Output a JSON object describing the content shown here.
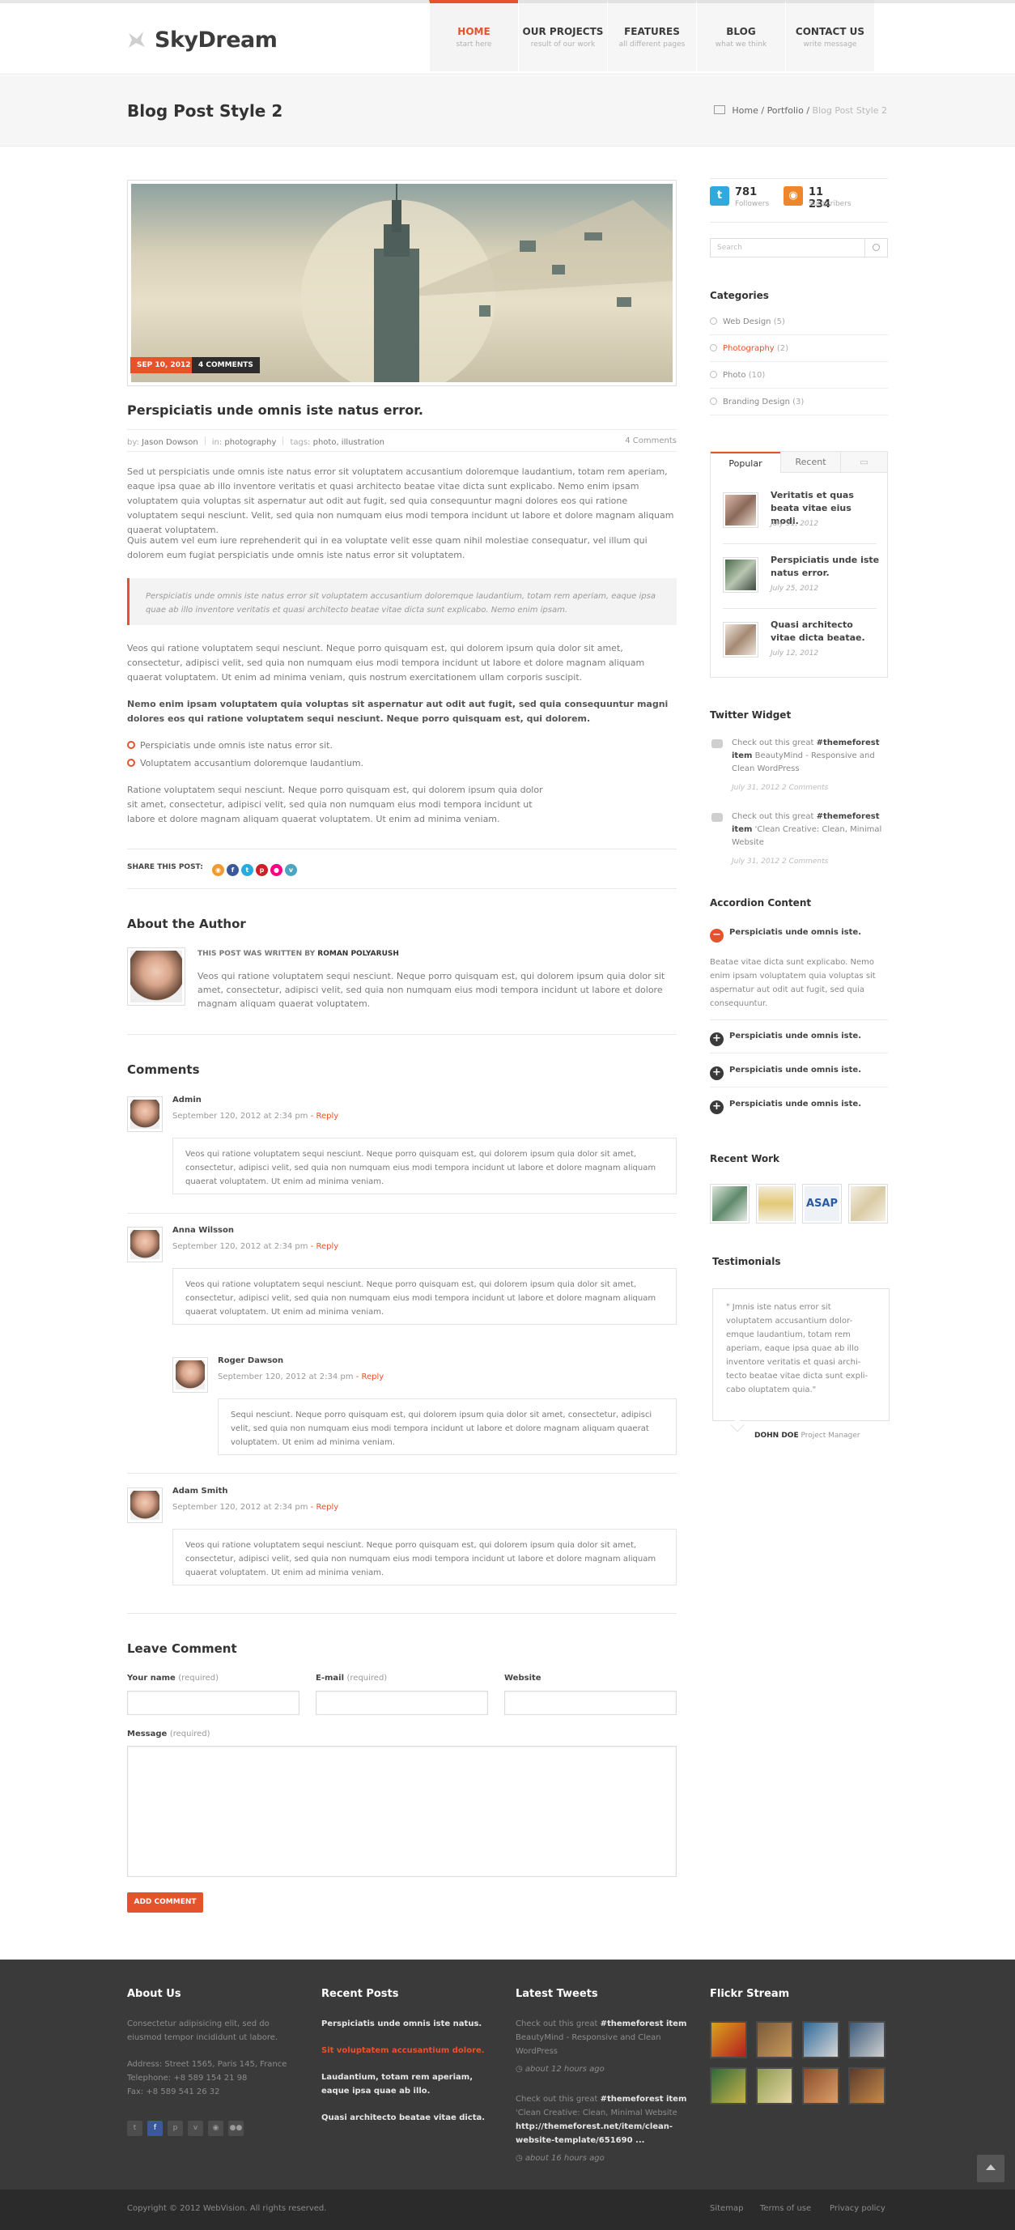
{
  "brand": {
    "name": "SkyDream"
  },
  "nav": [
    {
      "title": "HOME",
      "sub": "start here"
    },
    {
      "title": "OUR PROJECTS",
      "sub": "result of our work"
    },
    {
      "title": "FEATURES",
      "sub": "all different pages"
    },
    {
      "title": "BLOG",
      "sub": "what we think"
    },
    {
      "title": "CONTACT US",
      "sub": "write message"
    }
  ],
  "page": {
    "title": "Blog Post Style 2"
  },
  "breadcrumb": {
    "home": "Home",
    "sep": "/",
    "mid": "Portfolio",
    "current": "Blog Post Style 2"
  },
  "post": {
    "date_badge": "SEP 10, 2012",
    "comments_badge": "4 COMMENTS",
    "title": "Perspiciatis unde omnis iste natus error.",
    "meta": {
      "by_label": "by:",
      "author": "Jason Dowson",
      "in_label": "in:",
      "category": "photography",
      "tags_label": "tags:",
      "tags": "photo, illustration",
      "comments": "4 Comments"
    },
    "p1": "Sed ut perspiciatis unde omnis iste natus error sit voluptatem accusantium doloremque laudantium, totam rem aperiam, eaque ipsa quae ab illo inventore veritatis et quasi architecto beatae vitae dicta sunt explicabo. Nemo enim ipsam voluptatem quia voluptas sit aspernatur aut odit aut fugit, sed quia consequuntur magni dolores eos qui ratione voluptatem sequi nesciunt. Velit, sed quia non numquam eius modi tempora incidunt ut labore et dolore magnam aliquam quaerat voluptatem.",
    "p2": "Quis autem vel eum iure reprehenderit qui in ea voluptate velit esse quam nihil molestiae consequatur, vel illum qui dolorem eum fugiat perspiciatis unde omnis iste natus error sit voluptatem.",
    "quote": "Perspiciatis unde omnis iste natus error sit voluptatem accusantium doloremque laudantium, totam rem aperiam, eaque ipsa quae ab illo inventore veritatis et quasi architecto beatae vitae dicta sunt explicabo. Nemo enim ipsam.",
    "p3": "Veos qui ratione voluptatem sequi nesciunt. Neque porro quisquam est, qui dolorem ipsum quia dolor sit amet, consectetur, adipisci velit, sed quia non numquam eius modi tempora incidunt ut labore et dolore magnam aliquam quaerat voluptatem. Ut enim ad minima veniam, quis nostrum exercitationem ullam corporis suscipit.",
    "p4": "Nemo enim ipsam voluptatem quia voluptas sit aspernatur aut odit aut fugit, sed quia consequuntur magni dolores eos qui ratione voluptatem sequi nesciunt. Neque porro quisquam est, qui dolorem.",
    "list": [
      "Perspiciatis unde omnis iste natus error sit.",
      "Voluptatem accusantium doloremque laudantium."
    ],
    "p5": "Ratione voluptatem sequi nesciunt. Neque porro quisquam est, qui dolorem ipsum quia dolor sit amet, consectetur, adipisci velit, sed quia non numquam eius modi tempora incidunt ut labore et dolore magnam aliquam quaerat voluptatem. Ut enim ad minima veniam.",
    "share_label": "SHARE THIS POST:"
  },
  "author": {
    "heading": "About the Author",
    "by_label": "THIS POST WAS WRITTEN BY",
    "name": "ROMAN POLYARUSH",
    "bio": "Veos qui ratione voluptatem sequi nesciunt. Neque porro quisquam est, qui dolorem ipsum quia dolor sit amet, consectetur, adipisci velit, sed quia non numquam eius modi tempora incidunt ut labore et dolore magnam aliquam quaerat voluptatem."
  },
  "comments": {
    "heading": "Comments",
    "reply": "- Reply",
    "items": [
      {
        "name": "Admin",
        "date": "September 120, 2012 at 2:34 pm",
        "text": "Veos qui ratione voluptatem sequi nesciunt. Neque porro quisquam est, qui dolorem ipsum quia dolor sit amet, consectetur, adipisci velit, sed quia non numquam eius modi tempora incidunt ut labore et dolore magnam aliquam quaerat voluptatem. Ut enim ad minima veniam."
      },
      {
        "name": "Anna Wilsson",
        "date": "September 120, 2012 at 2:34 pm",
        "text": "Veos qui ratione voluptatem sequi nesciunt. Neque porro quisquam est, qui dolorem ipsum quia dolor sit amet, consectetur, adipisci velit, sed quia non numquam eius modi tempora incidunt ut labore et dolore magnam aliquam quaerat voluptatem. Ut enim ad minima veniam."
      },
      {
        "name": "Roger Dawson",
        "date": "September 120, 2012 at 2:34 pm",
        "text": "Sequi nesciunt. Neque porro quisquam est, qui dolorem ipsum quia dolor sit amet, consectetur, adipisci velit, sed quia non numquam eius modi tempora incidunt ut labore et dolore magnam aliquam quaerat voluptatem. Ut enim ad minima veniam."
      },
      {
        "name": "Adam Smith",
        "date": "September 120, 2012 at 2:34 pm",
        "text": "Veos qui ratione voluptatem sequi nesciunt. Neque porro quisquam est, qui dolorem ipsum quia dolor sit amet, consectetur, adipisci velit, sed quia non numquam eius modi tempora incidunt ut labore et dolore magnam aliquam quaerat voluptatem. Ut enim ad minima veniam."
      }
    ]
  },
  "form": {
    "heading": "Leave Comment",
    "name_label": "Your name",
    "email_label": "E-mail",
    "required": "(required)",
    "website_label": "Website",
    "message_label": "Message",
    "submit": "ADD COMMENT"
  },
  "sidebar": {
    "twitter": {
      "count": "781",
      "label": "Followers"
    },
    "rss": {
      "count": "11 234",
      "label": "Subscribers"
    },
    "search_placeholder": "Search",
    "categories_heading": "Categories",
    "categories": [
      {
        "name": "Web Design",
        "count": "(5)"
      },
      {
        "name": "Photography",
        "count": "(2)"
      },
      {
        "name": "Photo",
        "count": "(10)"
      },
      {
        "name": "Branding Design",
        "count": "(3)"
      }
    ],
    "tabs": [
      "Popular",
      "Recent"
    ],
    "popular": [
      {
        "title": "Veritatis et quas beata vitae eius modi.",
        "date": "July 31, 2012"
      },
      {
        "title": "Perspiciatis unde iste natus error.",
        "date": "July 25, 2012"
      },
      {
        "title": "Quasi architecto vitae dicta beatae.",
        "date": "July 12, 2012"
      }
    ],
    "twitter_heading": "Twitter Widget",
    "tweets": [
      {
        "pre": "Check out this great",
        "tag": "#themeforest item",
        "post": "BeautyMind - Responsive and Clean WordPress",
        "date": "July 31, 2012 2 Comments"
      },
      {
        "pre": "Check out this great",
        "tag": "#themeforest item",
        "post": "'Clean Creative: Clean, Minimal Website",
        "date": "July 31, 2012 2 Comments"
      }
    ],
    "accordion_heading": "Accordion Content",
    "accordion": [
      "Perspiciatis unde omnis iste.",
      "Perspiciatis unde omnis iste.",
      "Perspiciatis unde omnis iste.",
      "Perspiciatis unde omnis iste."
    ],
    "accordion_text": "Beatae vitae dicta sunt explicabo. Nemo enim ipsam voluptatem quia voluptas sit aspernatur aut odit aut fugit, sed quia consequuntur.",
    "recent_work_heading": "Recent Work",
    "testimonials_heading": "Testimonials",
    "testimonial": "\" Jmnis iste natus error sit voluptatem accusantium dolor-emque laudantium, totam rem aperiam, eaque ipsa quae ab illo inventore veritatis et quasi archi-tecto beatae vitae dicta sunt expli-cabo oluptatem quia.\"",
    "testimonial_name": "DOHN DOE",
    "testimonial_role": "Project Manager"
  },
  "footer": {
    "about_heading": "About Us",
    "about_text": "Consectetur adipisicing elit, sed do eiusmod tempor incididunt ut labore.",
    "address": "Address: Street 1565, Paris 145, France",
    "telephone": "Telephone: +8 589 154 21 98",
    "fax": "Fax: +8 589 541 26 32",
    "recent_heading": "Recent Posts",
    "recent": [
      "Perspiciatis unde omnis iste natus.",
      "Sit voluptatem accusantium dolore.",
      "Laudantium, totam rem aperiam, eaque ipsa quae ab illo.",
      "Quasi architecto beatae vitae dicta."
    ],
    "tweets_heading": "Latest Tweets",
    "tweets": [
      {
        "pre": "Check out this great",
        "tag": "#themeforest item",
        "post": "BeautyMind - Responsive and Clean WordPress",
        "time": "about 12 hours ago"
      },
      {
        "pre": "Check out this great",
        "tag": "#themeforest item",
        "post": "'Clean Creative: Clean, Minimal Website",
        "link": "http://themeforest.net/item/clean-website-template/651690 ...",
        "time": "about 16 hours ago"
      }
    ],
    "flickr_heading": "Flickr Stream",
    "copyright": "Copyright © 2012 WebVision. All rights reserved.",
    "links": [
      "Sitemap",
      "Terms of use",
      "Privacy policy"
    ]
  }
}
